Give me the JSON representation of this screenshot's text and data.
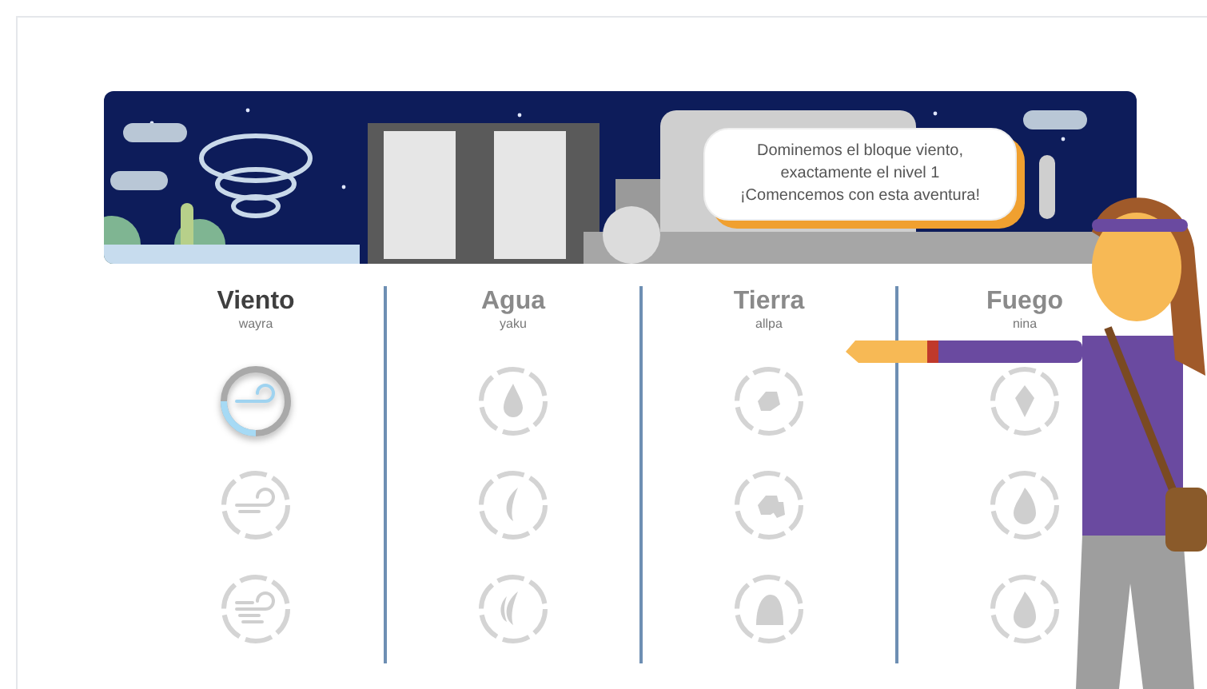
{
  "speech_bubble": {
    "lines": [
      "Dominemos el bloque viento,",
      "exactamente el nivel 1",
      "¡Comencemos con esta aventura!"
    ]
  },
  "elements": [
    {
      "kind": "wind",
      "name": "Viento",
      "native_name": "wayra",
      "selected": true,
      "levels": [
        {
          "active": true
        },
        {
          "active": false
        },
        {
          "active": false
        }
      ]
    },
    {
      "kind": "water",
      "name": "Agua",
      "native_name": "yaku",
      "selected": false,
      "levels": [
        {
          "active": false
        },
        {
          "active": false
        },
        {
          "active": false
        }
      ]
    },
    {
      "kind": "earth",
      "name": "Tierra",
      "native_name": "allpa",
      "selected": false,
      "levels": [
        {
          "active": false
        },
        {
          "active": false
        },
        {
          "active": false
        }
      ]
    },
    {
      "kind": "fire",
      "name": "Fuego",
      "native_name": "nina",
      "selected": false,
      "levels": [
        {
          "active": false
        },
        {
          "active": false
        },
        {
          "active": false
        }
      ]
    }
  ]
}
